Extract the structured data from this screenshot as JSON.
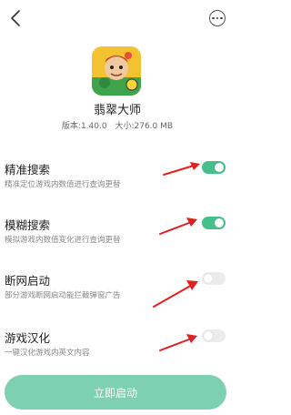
{
  "app": {
    "name": "翡翠大师",
    "version": "版本:1.40.0",
    "size": "大小:276.0 MB"
  },
  "settings": [
    {
      "title": "精准搜索",
      "desc": "精准定位游戏内数值进行查询更替",
      "enabled": true
    },
    {
      "title": "模糊搜索",
      "desc": "模拟游戏内数值变化进行查询更替",
      "enabled": true
    },
    {
      "title": "断网启动",
      "desc": "部分游戏断网启动能拦截弹窗广告",
      "enabled": false
    },
    {
      "title": "游戏汉化",
      "desc": "一键汉化游戏内英文内容",
      "enabled": false
    }
  ],
  "start_button": "立即启动",
  "colors": {
    "accent": "#46c08a",
    "button": "#7ed1b0",
    "arrow": "#e32020"
  },
  "icons": {
    "back": "chevron-left-icon",
    "more": "more-dots-icon"
  }
}
